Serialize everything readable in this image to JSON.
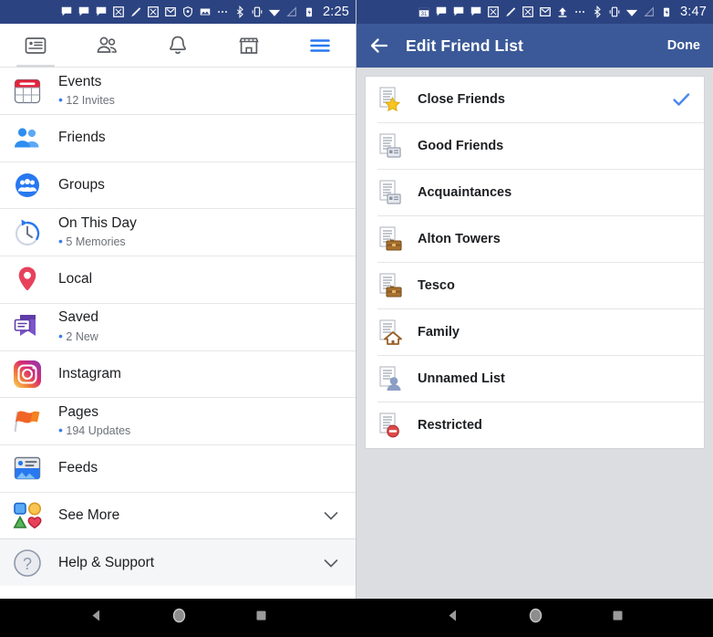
{
  "left_panel": {
    "statusbar": {
      "time": "2:25",
      "icons": [
        "messenger-icon",
        "messenger-icon",
        "messenger-icon",
        "photo-sync-icon",
        "edit-icon",
        "photo-sync-icon",
        "gmail-icon",
        "shield-icon",
        "gallery-icon",
        "more-icon",
        "bluetooth-icon",
        "vibrate-icon",
        "wifi-icon",
        "signal-icon",
        "battery-icon"
      ]
    },
    "topnav": [
      {
        "name": "news-feed-tab",
        "icon": "news-feed-icon"
      },
      {
        "name": "friends-tab",
        "icon": "friends-icon"
      },
      {
        "name": "notifications-tab",
        "icon": "bell-icon"
      },
      {
        "name": "marketplace-tab",
        "icon": "store-icon"
      },
      {
        "name": "menu-tab",
        "icon": "hamburger-menu-icon"
      }
    ],
    "menu_items": [
      {
        "label": "Events",
        "sub": "12 Invites",
        "icon": "calendar-icon",
        "chevron": false
      },
      {
        "label": "Friends",
        "sub": "",
        "icon": "friends-group-icon",
        "chevron": false
      },
      {
        "label": "Groups",
        "sub": "",
        "icon": "groups-circle-icon",
        "chevron": false
      },
      {
        "label": "On This Day",
        "sub": "5 Memories",
        "icon": "clock-history-icon",
        "chevron": false
      },
      {
        "label": "Local",
        "sub": "",
        "icon": "location-pin-icon",
        "chevron": false
      },
      {
        "label": "Saved",
        "sub": "2 New",
        "icon": "bookmark-icon",
        "chevron": false
      },
      {
        "label": "Instagram",
        "sub": "",
        "icon": "instagram-icon",
        "chevron": false
      },
      {
        "label": "Pages",
        "sub": "194 Updates",
        "icon": "flag-icon",
        "chevron": false
      },
      {
        "label": "Feeds",
        "sub": "",
        "icon": "feeds-image-icon",
        "chevron": false
      },
      {
        "label": "See More",
        "sub": "",
        "icon": "shapes-icon",
        "chevron": true
      }
    ],
    "help_item": {
      "label": "Help & Support",
      "icon": "question-circle-icon",
      "chevron": true
    }
  },
  "right_panel": {
    "statusbar": {
      "time": "3:47",
      "icons": [
        "calendar-31-icon",
        "messenger-icon",
        "messenger-icon",
        "messenger-icon",
        "photo-sync-icon",
        "edit-icon",
        "photo-sync-icon",
        "gmail-icon",
        "upload-icon",
        "more-icon",
        "bluetooth-icon",
        "vibrate-icon",
        "wifi-icon",
        "signal-icon",
        "battery-icon"
      ]
    },
    "actionbar": {
      "back_icon": "back-arrow-icon",
      "title": "Edit Friend List",
      "done_label": "Done"
    },
    "friend_lists": [
      {
        "label": "Close Friends",
        "icon": "list-star-icon",
        "selected": true
      },
      {
        "label": "Good Friends",
        "icon": "list-card-icon",
        "selected": false
      },
      {
        "label": "Acquaintances",
        "icon": "list-card-icon",
        "selected": false
      },
      {
        "label": "Alton Towers",
        "icon": "list-briefcase-icon",
        "selected": false
      },
      {
        "label": "Tesco",
        "icon": "list-briefcase-icon",
        "selected": false
      },
      {
        "label": "Family",
        "icon": "list-house-icon",
        "selected": false
      },
      {
        "label": "Unnamed List",
        "icon": "list-person-icon",
        "selected": false
      },
      {
        "label": "Restricted",
        "icon": "list-restricted-icon",
        "selected": false
      }
    ]
  },
  "android_nav": {
    "buttons": [
      "back-button",
      "home-button",
      "recents-button"
    ]
  },
  "colors": {
    "facebook_blue": "#3b5998",
    "statusbar_blue": "#2b4381",
    "accent_blue": "#3b7dec",
    "check_blue": "#4a87ef",
    "panel_bg": "#dcdde0"
  }
}
